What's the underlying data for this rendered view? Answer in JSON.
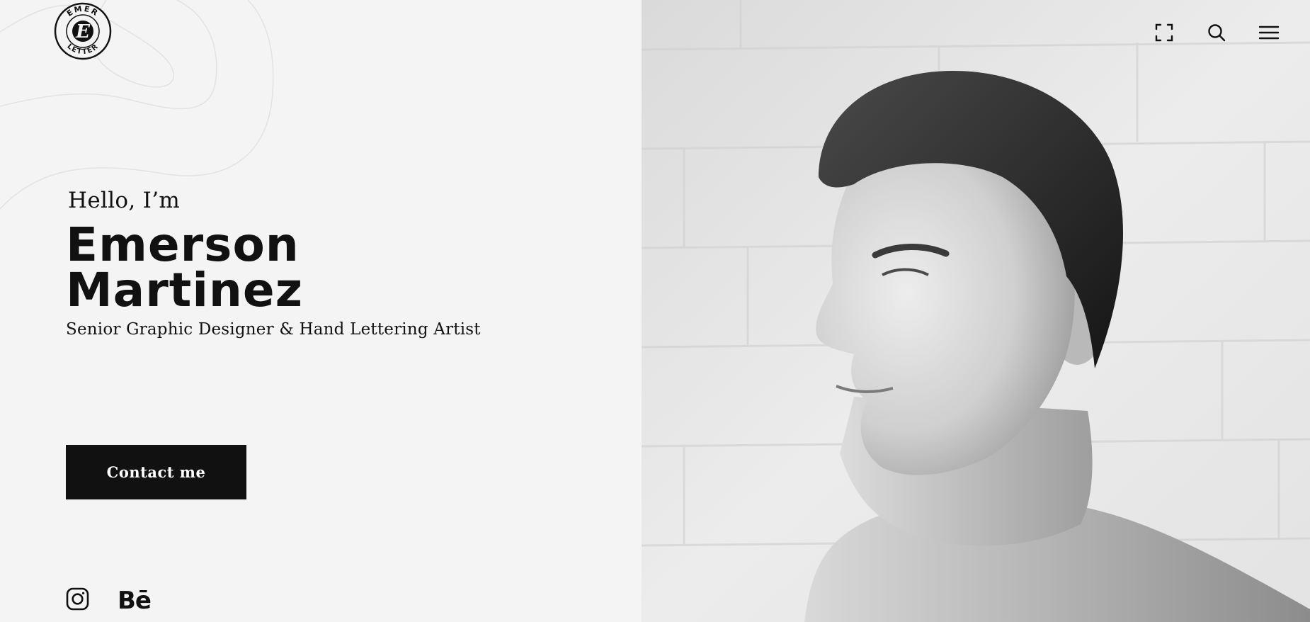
{
  "brand": {
    "logo_top_text": "EMER",
    "logo_bottom_text": "LETTER",
    "logo_monogram": "E"
  },
  "hero": {
    "greeting": "Hello, I’m",
    "name_first": "Emerson",
    "name_last": "Martinez",
    "tagline": "Senior Graphic Designer & Hand Lettering Artist"
  },
  "cta": {
    "label": "Contact me"
  },
  "social": [
    {
      "icon": "instagram-icon"
    },
    {
      "icon": "behance-icon",
      "label": "Bē"
    }
  ],
  "header_actions": [
    {
      "icon": "fullscreen-icon"
    },
    {
      "icon": "search-icon"
    },
    {
      "icon": "hamburger-menu-icon"
    }
  ],
  "colors": {
    "background": "#f4f4f4",
    "text": "#111111",
    "button_bg": "#111111",
    "button_text": "#ffffff"
  }
}
